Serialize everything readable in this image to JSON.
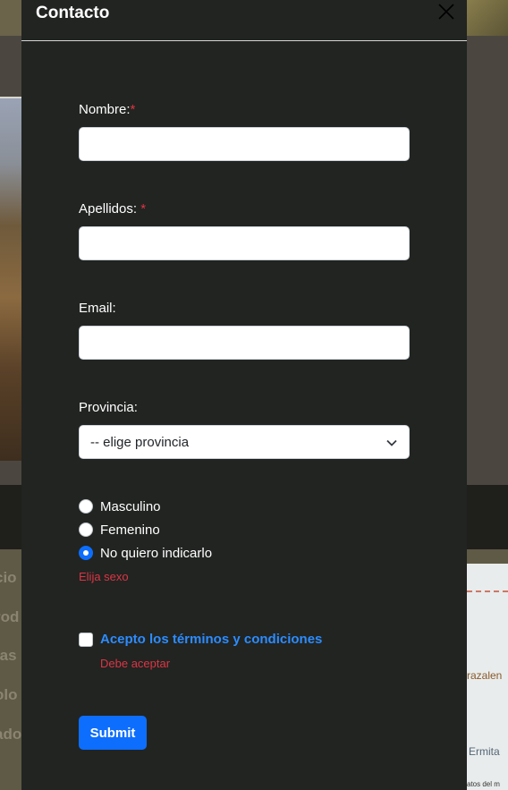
{
  "modal": {
    "title": "Contacto",
    "close_icon": "close-icon"
  },
  "form": {
    "nombre": {
      "label": "Nombre:",
      "required_mark": "*",
      "value": "",
      "placeholder": ""
    },
    "apellidos": {
      "label": "Apellidos:",
      "required_mark": "*",
      "value": "",
      "placeholder": ""
    },
    "email": {
      "label": "Email:",
      "value": "",
      "placeholder": ""
    },
    "provincia": {
      "label": "Provincia:",
      "selected": "-- elige provincia",
      "icon": "chevron-down-icon"
    },
    "sexo": {
      "options": [
        {
          "label": "Masculino",
          "checked": false
        },
        {
          "label": "Femenino",
          "checked": false
        },
        {
          "label": "No quiero indicarlo",
          "checked": true
        }
      ],
      "error": "Elija sexo"
    },
    "terminos": {
      "label": "Acepto los términos y condiciones",
      "checked": false,
      "error": "Debe aceptar"
    },
    "submit_label": "Submit"
  },
  "background": {
    "side_menu_fragments": [
      "cio",
      "rod",
      "tas",
      "olo",
      "ado"
    ],
    "map_labels": [
      "razalen",
      "Ermita",
      "atos del m"
    ]
  },
  "colors": {
    "modal_bg": "#212421",
    "accent": "#0d6efd",
    "error": "#dc3545",
    "link": "#2d8cff"
  }
}
